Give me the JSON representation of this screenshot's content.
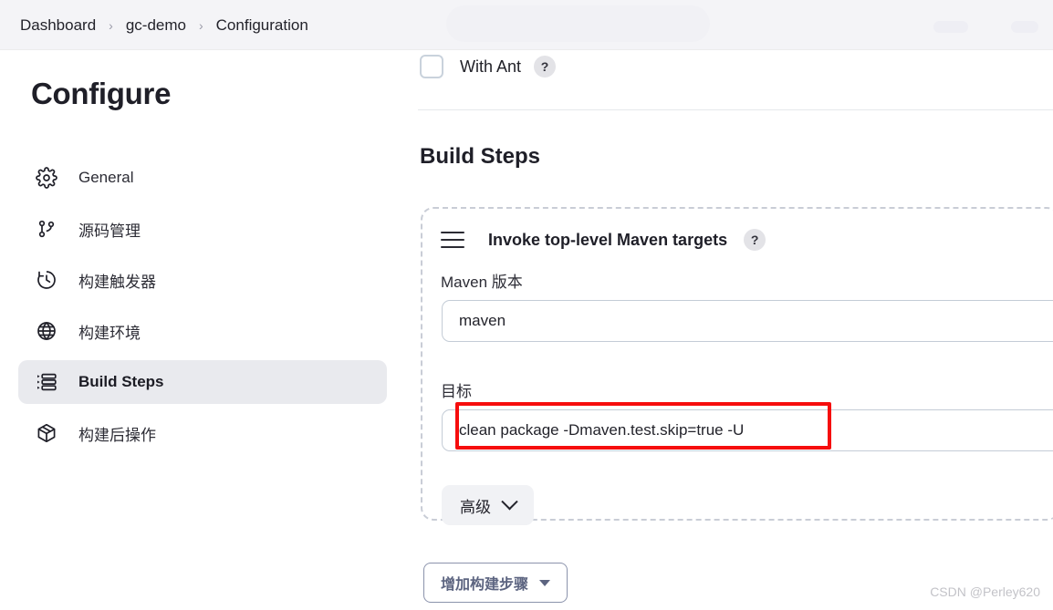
{
  "breadcrumb": {
    "items": [
      "Dashboard",
      "gc-demo",
      "Configuration"
    ],
    "separator": "›"
  },
  "sidebar": {
    "title": "Configure",
    "items": [
      {
        "label": "General",
        "icon": "gear-icon",
        "active": false
      },
      {
        "label": "源码管理",
        "icon": "git-branch-icon",
        "active": false
      },
      {
        "label": "构建触发器",
        "icon": "clock-icon",
        "active": false
      },
      {
        "label": "构建环境",
        "icon": "globe-icon",
        "active": false
      },
      {
        "label": "Build Steps",
        "icon": "list-steps-icon",
        "active": true
      },
      {
        "label": "构建后操作",
        "icon": "package-icon",
        "active": false
      }
    ]
  },
  "main": {
    "with_ant": {
      "label": "With Ant",
      "checked": false,
      "help": "?"
    },
    "section_title": "Build Steps",
    "step": {
      "title": "Invoke top-level Maven targets",
      "help": "?",
      "maven_version_label": "Maven 版本",
      "maven_version_value": "maven",
      "goals_label": "目标",
      "goals_value": "clean package -Dmaven.test.skip=true -U",
      "advanced_label": "高级"
    },
    "add_step_button": "增加构建步骤"
  },
  "watermark": "CSDN @Perley620",
  "colors": {
    "annotation": "#f60d0d",
    "header_bg": "#f4f4f7",
    "active_nav_bg": "#e9eaee"
  }
}
